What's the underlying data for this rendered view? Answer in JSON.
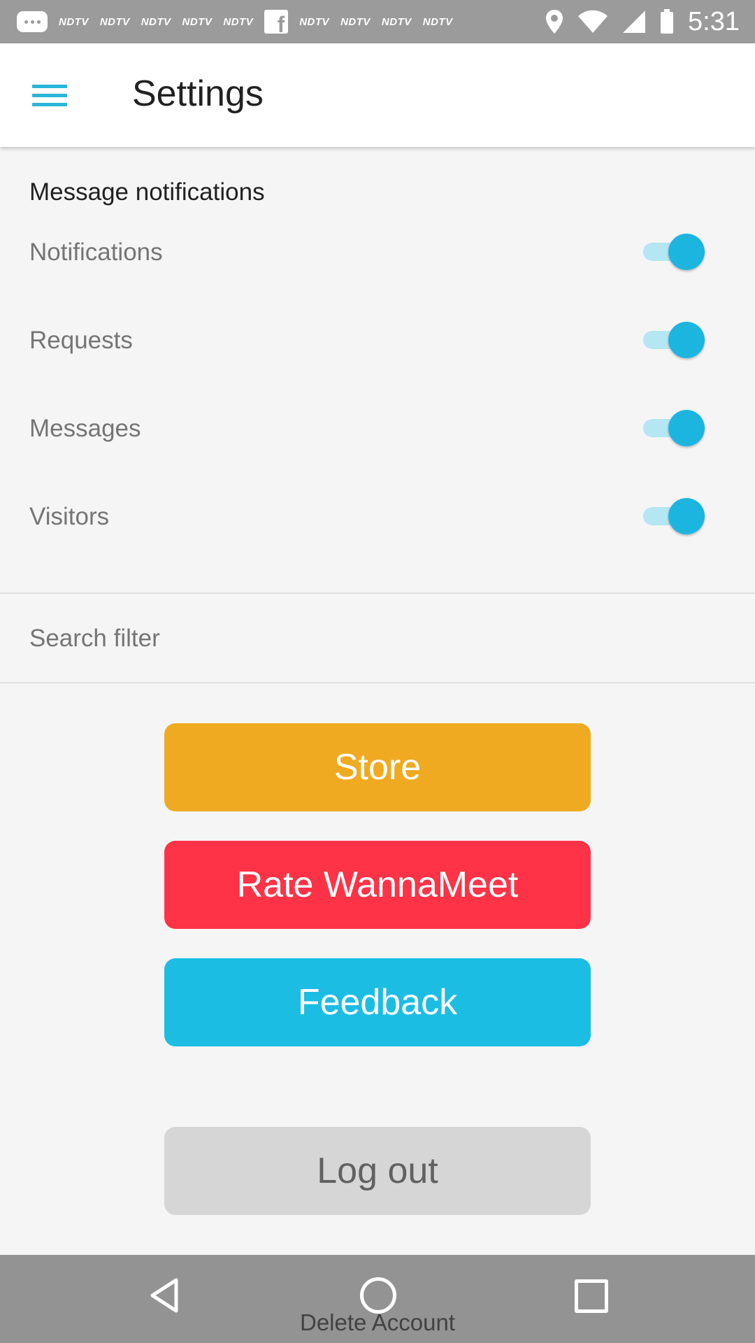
{
  "status_bar": {
    "time": "5:31",
    "notification_labels": [
      "NDTV",
      "NDTV",
      "NDTV",
      "NDTV",
      "NDTV",
      "NDTV",
      "NDTV",
      "NDTV",
      "NDTV"
    ],
    "icons": [
      "chat-bubble-icon",
      "facebook-icon",
      "location-icon",
      "wifi-icon",
      "signal-icon",
      "battery-icon"
    ]
  },
  "app_bar": {
    "title": "Settings",
    "menu_icon": "hamburger-menu-icon",
    "accent": "#29b6d8"
  },
  "message_notifications": {
    "title": "Message notifications",
    "items": [
      {
        "label": "Notifications",
        "enabled": true
      },
      {
        "label": "Requests",
        "enabled": true
      },
      {
        "label": "Messages",
        "enabled": true
      },
      {
        "label": "Visitors",
        "enabled": true
      }
    ],
    "toggle_color": "#1cb5e0"
  },
  "search_filter": {
    "label": "Search filter"
  },
  "buttons": {
    "store": {
      "label": "Store",
      "color": "#f0aa21"
    },
    "rate": {
      "label": "Rate WannaMeet",
      "color": "#ff3347"
    },
    "feedback": {
      "label": "Feedback",
      "color": "#1bbde3"
    },
    "logout": {
      "label": "Log out",
      "color": "#d6d6d6"
    }
  },
  "delete_account": {
    "label": "Delete Account"
  },
  "nav_bar": {
    "icons": [
      "back-icon",
      "home-icon",
      "recent-apps-icon"
    ]
  }
}
